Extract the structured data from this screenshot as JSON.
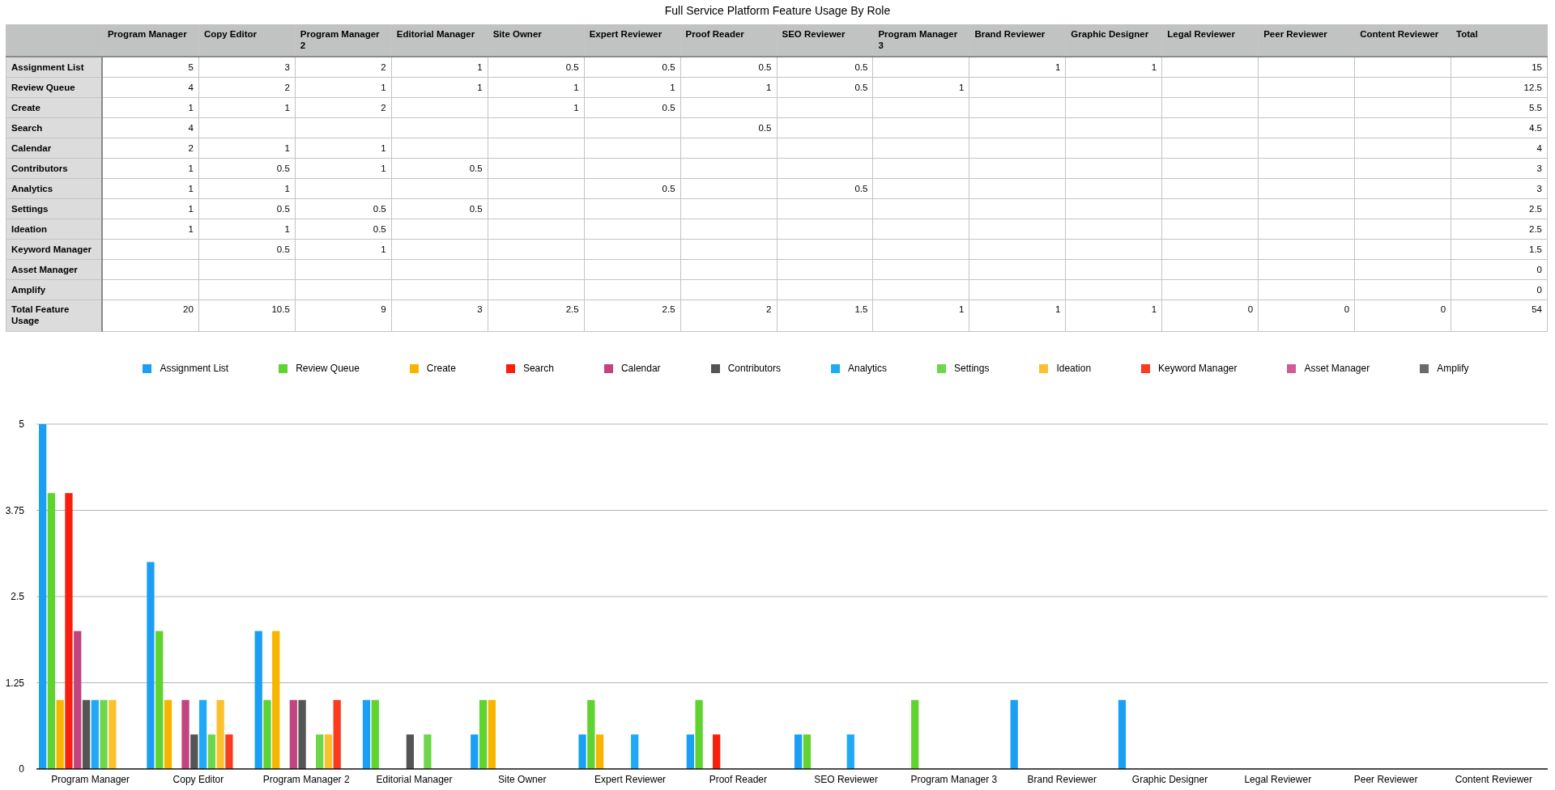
{
  "title": "Full Service Platform Feature Usage By Role",
  "table": {
    "columns": [
      "Program Manager",
      "Copy Editor",
      "Program Manager 2",
      "Editorial Manager",
      "Site Owner",
      "Expert Reviewer",
      "Proof Reader",
      "SEO Reviewer",
      "Program Manager 3",
      "Brand Reviewer",
      "Graphic Designer",
      "Legal Reviewer",
      "Peer Reviewer",
      "Content Reviewer",
      "Total"
    ],
    "rows": [
      {
        "label": "Assignment List",
        "cells": [
          "5",
          "3",
          "2",
          "1",
          "0.5",
          "0.5",
          "0.5",
          "0.5",
          null,
          "1",
          "1",
          null,
          null,
          null,
          "15"
        ]
      },
      {
        "label": "Review Queue",
        "cells": [
          "4",
          "2",
          "1",
          "1",
          "1",
          "1",
          "1",
          "0.5",
          "1",
          null,
          null,
          null,
          null,
          null,
          "12.5"
        ]
      },
      {
        "label": "Create",
        "cells": [
          "1",
          "1",
          "2",
          null,
          "1",
          "0.5",
          null,
          null,
          null,
          null,
          null,
          null,
          null,
          null,
          "5.5"
        ]
      },
      {
        "label": "Search",
        "cells": [
          "4",
          null,
          null,
          null,
          null,
          null,
          "0.5",
          null,
          null,
          null,
          null,
          null,
          null,
          null,
          "4.5"
        ]
      },
      {
        "label": "Calendar",
        "cells": [
          "2",
          "1",
          "1",
          null,
          null,
          null,
          null,
          null,
          null,
          null,
          null,
          null,
          null,
          null,
          "4"
        ]
      },
      {
        "label": "Contributors",
        "cells": [
          "1",
          "0.5",
          "1",
          "0.5",
          null,
          null,
          null,
          null,
          null,
          null,
          null,
          null,
          null,
          null,
          "3"
        ]
      },
      {
        "label": "Analytics",
        "cells": [
          "1",
          "1",
          null,
          null,
          null,
          "0.5",
          null,
          "0.5",
          null,
          null,
          null,
          null,
          null,
          null,
          "3"
        ]
      },
      {
        "label": "Settings",
        "cells": [
          "1",
          "0.5",
          "0.5",
          "0.5",
          null,
          null,
          null,
          null,
          null,
          null,
          null,
          null,
          null,
          null,
          "2.5"
        ]
      },
      {
        "label": "Ideation",
        "cells": [
          "1",
          "1",
          "0.5",
          null,
          null,
          null,
          null,
          null,
          null,
          null,
          null,
          null,
          null,
          null,
          "2.5"
        ]
      },
      {
        "label": "Keyword Manager",
        "cells": [
          null,
          "0.5",
          "1",
          null,
          null,
          null,
          null,
          null,
          null,
          null,
          null,
          null,
          null,
          null,
          "1.5"
        ]
      },
      {
        "label": "Asset Manager",
        "cells": [
          null,
          null,
          null,
          null,
          null,
          null,
          null,
          null,
          null,
          null,
          null,
          null,
          null,
          null,
          "0"
        ]
      },
      {
        "label": "Amplify",
        "cells": [
          null,
          null,
          null,
          null,
          null,
          null,
          null,
          null,
          null,
          null,
          null,
          null,
          null,
          null,
          "0"
        ]
      },
      {
        "label": "Total Feature Usage",
        "cells": [
          "20",
          "10.5",
          "9",
          "3",
          "2.5",
          "2.5",
          "2",
          "1.5",
          "1",
          "1",
          "1",
          "0",
          "0",
          "0",
          "54"
        ]
      }
    ]
  },
  "chart": {
    "chart_data": {
      "type": "bar",
      "categories": [
        "Program Manager",
        "Copy Editor",
        "Program Manager 2",
        "Editorial Manager",
        "Site Owner",
        "Expert Reviewer",
        "Proof Reader",
        "SEO Reviewer",
        "Program Manager 3",
        "Brand Reviewer",
        "Graphic Designer",
        "Legal Reviewer",
        "Peer Reviewer",
        "Content Reviewer"
      ],
      "ylim": [
        0,
        5
      ],
      "grid": true,
      "yticks": [
        0,
        1.25,
        2.5,
        3.75,
        5
      ],
      "series": [
        {
          "name": "Assignment List",
          "color": "#1a9ff5",
          "values": [
            5,
            3,
            2,
            1,
            0.5,
            0.5,
            0.5,
            0.5,
            null,
            1,
            1,
            null,
            null,
            null
          ]
        },
        {
          "name": "Review Queue",
          "color": "#5fd330",
          "values": [
            4,
            2,
            1,
            1,
            1,
            1,
            1,
            0.5,
            1,
            null,
            null,
            null,
            null,
            null
          ]
        },
        {
          "name": "Create",
          "color": "#f7b500",
          "values": [
            1,
            1,
            2,
            null,
            1,
            0.5,
            null,
            null,
            null,
            null,
            null,
            null,
            null,
            null
          ]
        },
        {
          "name": "Search",
          "color": "#f91f0d",
          "values": [
            4,
            null,
            null,
            null,
            null,
            null,
            0.5,
            null,
            null,
            null,
            null,
            null,
            null,
            null
          ]
        },
        {
          "name": "Calendar",
          "color": "#c2447f",
          "values": [
            2,
            1,
            1,
            null,
            null,
            null,
            null,
            null,
            null,
            null,
            null,
            null,
            null,
            null
          ]
        },
        {
          "name": "Contributors",
          "color": "#555555",
          "values": [
            1,
            0.5,
            1,
            0.5,
            null,
            null,
            null,
            null,
            null,
            null,
            null,
            null,
            null,
            null
          ]
        },
        {
          "name": "Analytics",
          "color": "#1fa9f7",
          "values": [
            1,
            1,
            null,
            null,
            null,
            0.5,
            null,
            0.5,
            null,
            null,
            null,
            null,
            null,
            null
          ]
        },
        {
          "name": "Settings",
          "color": "#6dd64a",
          "values": [
            1,
            0.5,
            0.5,
            0.5,
            null,
            null,
            null,
            null,
            null,
            null,
            null,
            null,
            null,
            null
          ]
        },
        {
          "name": "Ideation",
          "color": "#fbc02d",
          "values": [
            1,
            1,
            0.5,
            null,
            null,
            null,
            null,
            null,
            null,
            null,
            null,
            null,
            null,
            null
          ]
        },
        {
          "name": "Keyword Manager",
          "color": "#fb3b1f",
          "values": [
            null,
            0.5,
            1,
            null,
            null,
            null,
            null,
            null,
            null,
            null,
            null,
            null,
            null,
            null
          ]
        },
        {
          "name": "Asset Manager",
          "color": "#cf5c94",
          "values": [
            null,
            null,
            null,
            null,
            null,
            null,
            null,
            null,
            null,
            null,
            null,
            null,
            null,
            null
          ]
        },
        {
          "name": "Amplify",
          "color": "#6b6b6b",
          "values": [
            null,
            null,
            null,
            null,
            null,
            null,
            null,
            null,
            null,
            null,
            null,
            null,
            null,
            null
          ]
        }
      ]
    }
  }
}
